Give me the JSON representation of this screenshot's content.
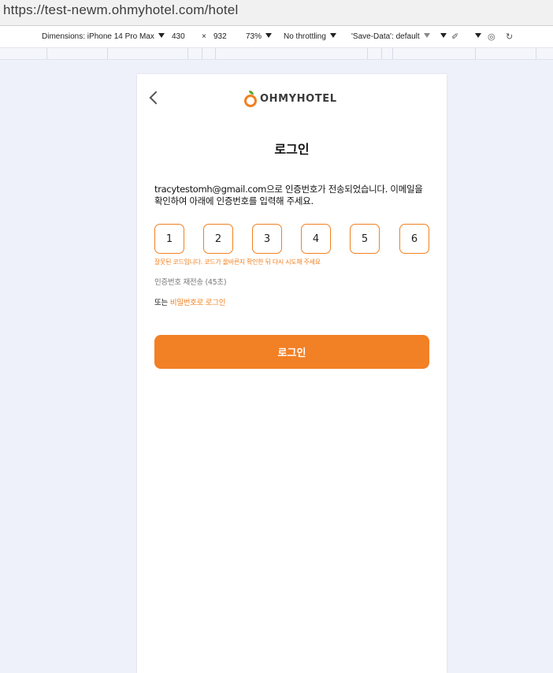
{
  "browser": {
    "url": "https://test-newm.ohmyhotel.com/hotel"
  },
  "devtools": {
    "dimensions_label": "Dimensions: iPhone 14 Pro Max",
    "width": "430",
    "times": "×",
    "height": "932",
    "zoom": "73%",
    "throttling": "No throttling",
    "save_data": "'Save-Data': default"
  },
  "app": {
    "logo_text": "OHMYHOTEL",
    "title": "로그인",
    "description": "tracytestomh@gmail.com으로 인증번호가 전송되었습니다. 이메일을 확인하여 아래에 인증번호를 입력해 주세요.",
    "code_digits": [
      "1",
      "2",
      "3",
      "4",
      "5",
      "6"
    ],
    "error_message": "잘못된 코드입니다. 코드가 올바른지 확인한 뒤 다시 시도해 주세요",
    "resend_text": "인증번호 재전송 (45초)",
    "alt_prefix": "또는",
    "alt_link": "비밀번호로 로그인",
    "login_button": "로그인"
  },
  "colors": {
    "accent": "#f28020",
    "background": "#eef1f9"
  }
}
